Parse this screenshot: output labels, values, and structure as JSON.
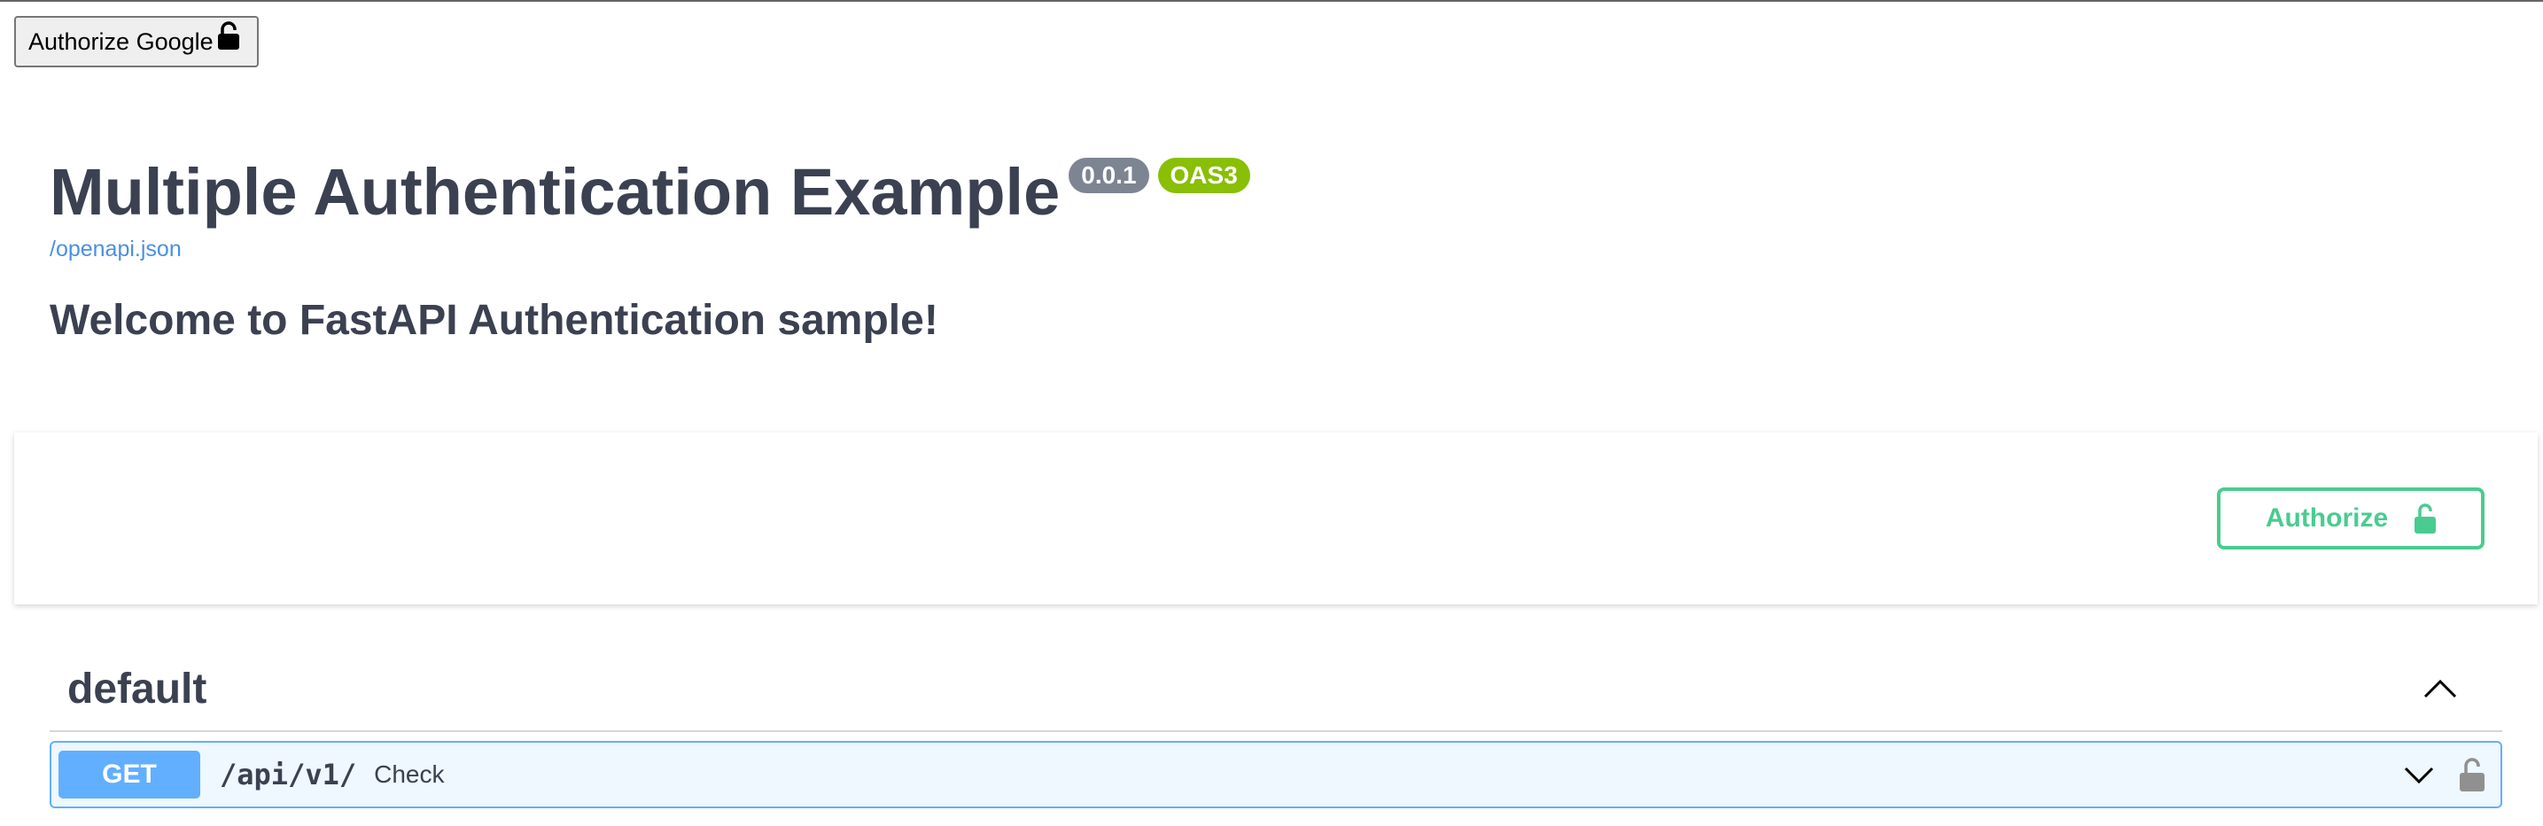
{
  "top_button": {
    "label": "Authorize Google",
    "icon": "lock-icon"
  },
  "info": {
    "title": "Multiple Authentication Example",
    "version": "0.0.1",
    "oas_badge": "OAS3",
    "spec_link": "/openapi.json",
    "description": "Welcome to FastAPI Authentication sample!"
  },
  "scheme": {
    "authorize_label": "Authorize",
    "icon": "unlock-icon"
  },
  "tag": {
    "name": "default",
    "toggle_icon": "chevron-up-icon",
    "operations": [
      {
        "method": "GET",
        "path": "/api/v1/",
        "summary": "Check",
        "expand_icon": "chevron-down-icon",
        "lock_icon": "unlock-icon"
      }
    ]
  },
  "colors": {
    "get": "#61affe",
    "authorize": "#49cc90",
    "version_badge": "#7d8492",
    "oas_badge": "#89bf04",
    "link": "#4990e2",
    "text": "#3b4151"
  }
}
